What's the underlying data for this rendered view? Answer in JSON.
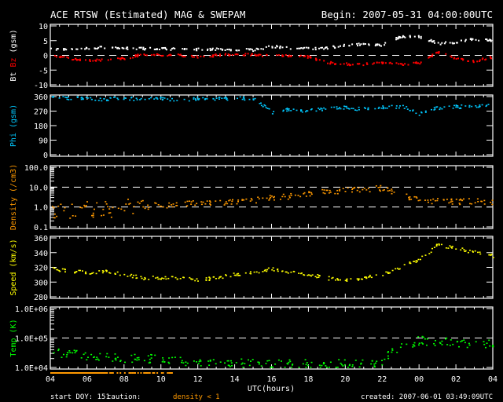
{
  "title": "ACE RTSW (Estimated) MAG & SWEPAM",
  "begin": "Begin: 2007-05-31 04:00:00UTC",
  "footer": {
    "start_doy": "start DOY: 151",
    "caution": "caution:",
    "caution_note": "density < 1",
    "created": "created: 2007-06-01 03:49:09UTC"
  },
  "xlabel": "UTC(hours)",
  "x_ticks": [
    "04",
    "06",
    "08",
    "10",
    "12",
    "14",
    "16",
    "18",
    "20",
    "22",
    "00",
    "02",
    "04"
  ],
  "colors": {
    "bt": "#ffffff",
    "bz": "#ff0000",
    "phi": "#00c8ff",
    "density": "#ff9900",
    "speed": "#ffff00",
    "temp": "#00ff00"
  },
  "caution_hours": [
    0,
    6.8
  ],
  "chart_data": [
    {
      "type": "scatter",
      "ylabel_parts": [
        "Bt",
        "Bz",
        "(gsm)"
      ],
      "ylim": [
        -10,
        10
      ],
      "scale": "linear",
      "yticks": [
        "10",
        "5",
        "0",
        "-5",
        "-10"
      ],
      "ytick_values": [
        10,
        5,
        0,
        -5,
        -10
      ],
      "dashed": [
        0
      ],
      "x_hours": [
        0,
        1,
        2,
        3,
        4,
        5,
        6,
        7,
        8,
        9,
        10,
        11,
        12,
        13,
        14,
        15,
        16,
        17,
        18,
        19,
        20,
        21,
        22,
        23,
        24
      ],
      "series": [
        {
          "name": "Bt",
          "color": "#ffffff",
          "values": [
            2,
            2.2,
            2.3,
            2.8,
            2.4,
            2.3,
            2.2,
            2.1,
            2,
            2,
            2,
            1.8,
            3,
            2.5,
            2.2,
            2.5,
            3.5,
            3.8,
            3.5,
            6.5,
            6.3,
            4,
            4.5,
            5.5,
            5
          ]
        },
        {
          "name": "Bz",
          "color": "#ff0000",
          "values": [
            0,
            -1,
            -1.8,
            -1.5,
            -1,
            0.3,
            0,
            0,
            -0.5,
            0,
            0.3,
            0.3,
            -0.3,
            -0.2,
            -0.5,
            -2.5,
            -3,
            -3,
            -2.5,
            -3,
            -2.5,
            1,
            -1,
            -2,
            -0.5
          ]
        }
      ]
    },
    {
      "type": "scatter",
      "ylabel_parts": [
        "Phi (gsm)"
      ],
      "ylim": [
        0,
        360
      ],
      "scale": "linear",
      "yticks": [
        "360",
        "270",
        "180",
        "90",
        "0"
      ],
      "ytick_values": [
        360,
        270,
        180,
        90,
        0
      ],
      "dashed": [],
      "x_hours": [
        0,
        1,
        2,
        3,
        4,
        5,
        6,
        7,
        8,
        9,
        10,
        11,
        12,
        13,
        14,
        15,
        16,
        17,
        18,
        19,
        20,
        21,
        22,
        23,
        24
      ],
      "series": [
        {
          "name": "Phi",
          "color": "#00c8ff",
          "values": [
            355,
            350,
            345,
            340,
            350,
            340,
            345,
            340,
            345,
            345,
            350,
            345,
            260,
            280,
            270,
            285,
            290,
            280,
            290,
            300,
            250,
            290,
            295,
            300,
            310
          ]
        }
      ]
    },
    {
      "type": "scatter",
      "ylabel_parts": [
        "Density (/cm3)"
      ],
      "ylim": [
        0.1,
        100
      ],
      "scale": "log",
      "yticks": [
        "100.0",
        "10.0",
        "1.0",
        "0.1"
      ],
      "ytick_values": [
        100,
        10,
        1,
        0.1
      ],
      "dashed": [
        10,
        1
      ],
      "x_hours": [
        0,
        1,
        2,
        3,
        4,
        5,
        6,
        7,
        8,
        9,
        10,
        11,
        12,
        13,
        14,
        15,
        16,
        17,
        18,
        19,
        20,
        21,
        22,
        23,
        24
      ],
      "series": [
        {
          "name": "Density",
          "color": "#ff9900",
          "values": [
            0.5,
            0.6,
            0.7,
            0.8,
            0.9,
            1.0,
            1.2,
            1.3,
            1.5,
            1.6,
            1.7,
            2,
            3,
            3.5,
            4.5,
            5.5,
            6.5,
            8,
            8.5,
            4,
            2,
            2,
            1.8,
            2,
            1.6
          ]
        }
      ]
    },
    {
      "type": "scatter",
      "ylabel_parts": [
        "Speed (km/s)"
      ],
      "ylim": [
        280,
        360
      ],
      "scale": "linear",
      "yticks": [
        "360",
        "340",
        "320",
        "300",
        "280"
      ],
      "ytick_values": [
        360,
        340,
        320,
        300,
        280
      ],
      "dashed": [],
      "x_hours": [
        0,
        1,
        2,
        3,
        4,
        5,
        6,
        7,
        8,
        9,
        10,
        11,
        12,
        13,
        14,
        15,
        16,
        17,
        18,
        19,
        20,
        21,
        22,
        23,
        24
      ],
      "series": [
        {
          "name": "Speed",
          "color": "#ffff00",
          "values": [
            318,
            315,
            312,
            315,
            310,
            305,
            306,
            305,
            303,
            305,
            310,
            312,
            318,
            313,
            310,
            305,
            302,
            305,
            310,
            320,
            330,
            350,
            345,
            340,
            335
          ]
        }
      ]
    },
    {
      "type": "scatter",
      "ylabel_parts": [
        "Temp (K)"
      ],
      "ylim": [
        10000,
        1000000
      ],
      "scale": "log",
      "yticks": [
        "1.0E+06",
        "1.0E+05",
        "1.0E+04"
      ],
      "ytick_values": [
        1000000,
        100000,
        10000
      ],
      "dashed": [
        100000
      ],
      "x_hours": [
        0,
        1,
        2,
        3,
        4,
        5,
        6,
        7,
        8,
        9,
        10,
        11,
        12,
        13,
        14,
        15,
        16,
        17,
        18,
        19,
        20,
        21,
        22,
        23,
        24
      ],
      "series": [
        {
          "name": "Temp",
          "color": "#00ff00",
          "values": [
            30000,
            30000,
            25000,
            22000,
            20000,
            20000,
            18000,
            16000,
            15000,
            15000,
            14000,
            14000,
            13000,
            13000,
            13000,
            13000,
            13000,
            14000,
            15000,
            50000,
            80000,
            70000,
            70000,
            60000,
            60000
          ]
        }
      ]
    }
  ]
}
